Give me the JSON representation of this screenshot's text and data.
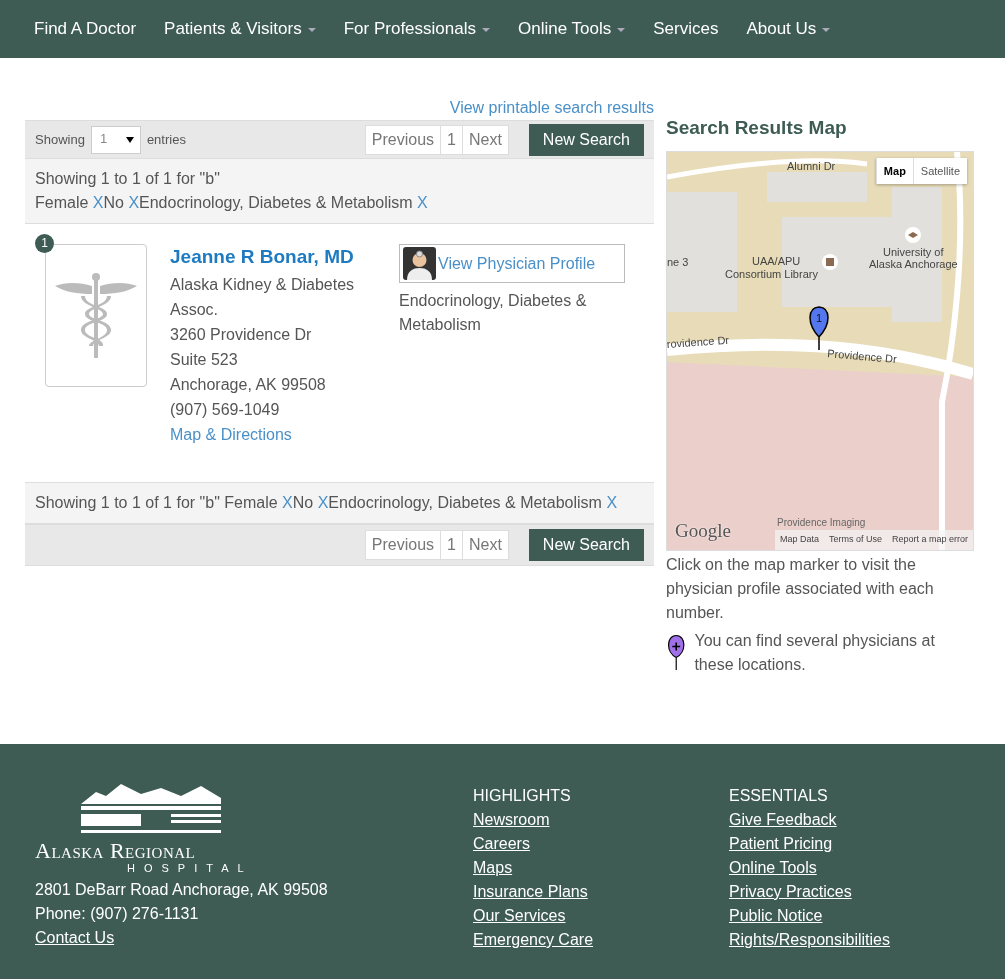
{
  "nav": [
    {
      "label": "Find A Doctor",
      "dropdown": false
    },
    {
      "label": "Patients & Visitors",
      "dropdown": true
    },
    {
      "label": "For Professionals",
      "dropdown": true
    },
    {
      "label": "Online Tools",
      "dropdown": true
    },
    {
      "label": "Services",
      "dropdown": false
    },
    {
      "label": "About Us",
      "dropdown": true
    }
  ],
  "printable_link": "View printable search results",
  "top_bar": {
    "showing_label": "Showing",
    "page_length": "1",
    "entries_label": "entries",
    "pager": [
      "Previous",
      "1",
      "Next"
    ],
    "new_search": "New Search"
  },
  "summary_top": {
    "text": "Showing 1 to 1 of 1 for \"b\"",
    "filters": [
      {
        "label": "Female",
        "remove": "X"
      },
      {
        "label": "No",
        "remove": "X"
      },
      {
        "label": "Endocrinology, Diabetes & Metabolism",
        "remove": "X"
      }
    ]
  },
  "physician": {
    "marker": "1",
    "name": "Jeanne R Bonar, MD",
    "lines": [
      "Alaska Kidney & Diabetes Assoc.",
      "3260 Providence Dr",
      "Suite 523",
      "Anchorage, AK 99508",
      "(907) 569-1049"
    ],
    "map_link": "Map & Directions",
    "profile_link": "View Physician Profile",
    "specialty": "Endocrinology, Diabetes & Metabolism"
  },
  "summary_bottom": {
    "text": "Showing 1 to 1 of 1 for \"b\"",
    "filters": [
      {
        "label": "Female",
        "remove": "X"
      },
      {
        "label": "No",
        "remove": "X"
      },
      {
        "label": "Endocrinology, Diabetes & Metabolism",
        "remove": "X"
      }
    ]
  },
  "bottom_bar": {
    "pager": [
      "Previous",
      "1",
      "Next"
    ],
    "new_search": "New Search"
  },
  "map": {
    "title": "Search Results Map",
    "map_types": [
      {
        "label": "Map",
        "selected": true
      },
      {
        "label": "Satellite",
        "selected": false
      }
    ],
    "labels": [
      "Alumni Dr",
      "ne 3",
      "UAA/APU",
      "Consortium Library",
      "University of",
      "Alaska Anchorage",
      "rovidence Dr",
      "Providence Dr",
      "Providence Imaging"
    ],
    "marker": "1",
    "logo": "Google",
    "footer_links": [
      "Map Data",
      "Terms of Use",
      "Report a map error"
    ],
    "caption": "Click on the map marker to visit the physician profile associated with each number.",
    "legend": "You can find several physicians at these locations."
  },
  "footer": {
    "logo_name": "Alaska Regional",
    "logo_sub": "HOSPITAL",
    "address": "2801 DeBarr Road Anchorage, AK 99508",
    "phone": "Phone: (907) 276-1131",
    "contact": "Contact Us",
    "columns": [
      {
        "heading": "HIGHLIGHTS",
        "links": [
          "Newsroom",
          "Careers",
          "Maps",
          "Insurance Plans",
          "Our Services",
          "Emergency Care"
        ]
      },
      {
        "heading": "ESSENTIALS",
        "links": [
          "Give Feedback",
          "Patient Pricing",
          "Online Tools",
          "Privacy Practices",
          "Public Notice",
          "Rights/Responsibilities"
        ]
      }
    ]
  }
}
